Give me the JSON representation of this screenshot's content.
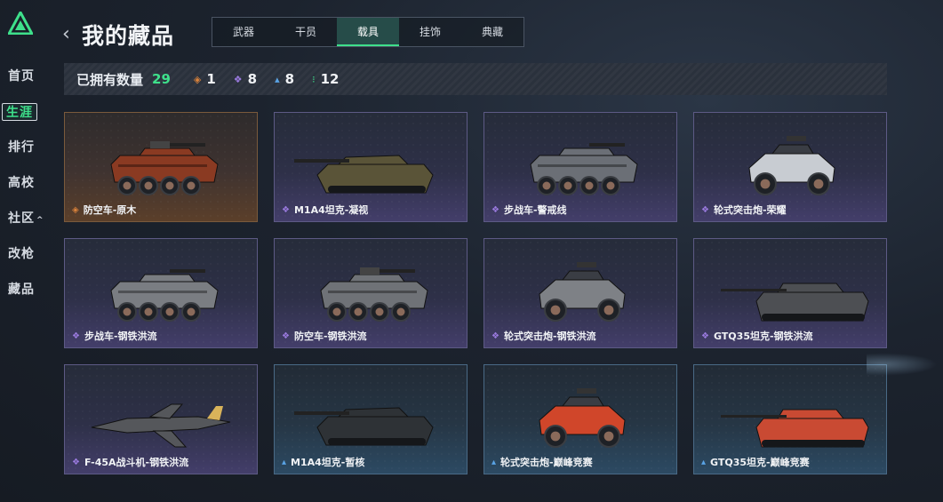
{
  "sidebar": {
    "items": [
      {
        "label": "首页"
      },
      {
        "label": "生涯",
        "active": true
      },
      {
        "label": "排行"
      },
      {
        "label": "高校"
      },
      {
        "label": "社区",
        "caret": "^"
      },
      {
        "label": "改枪"
      },
      {
        "label": "藏品"
      }
    ]
  },
  "header": {
    "back_icon": "‹",
    "title": "我的藏品",
    "tabs": [
      {
        "label": "武器"
      },
      {
        "label": "干员"
      },
      {
        "label": "载具",
        "active": true
      },
      {
        "label": "挂饰"
      },
      {
        "label": "典藏"
      }
    ]
  },
  "stats": {
    "owned_label": "已拥有数量",
    "owned_total": "29",
    "rarities": [
      {
        "icon": "orange-gem-icon",
        "color": "#d9823b",
        "count": "1"
      },
      {
        "icon": "purple-gem-icon",
        "color": "#9b7be0",
        "count": "8"
      },
      {
        "icon": "blue-gem-icon",
        "color": "#5aa4e6",
        "count": "8"
      },
      {
        "icon": "green-gem-icon",
        "color": "#3ee08b",
        "count": "12"
      }
    ]
  },
  "colors": {
    "accent": "#3ee08b",
    "orange": "#d9823b",
    "purple": "#9b7be0",
    "blue": "#5aa4e6"
  },
  "vehicles": [
    {
      "name": "防空车-原木",
      "rarity": "orange",
      "type": "wheeled-aa",
      "tint": "#8a3a22"
    },
    {
      "name": "M1A4坦克-凝视",
      "rarity": "purple",
      "type": "tank",
      "tint": "#5a5438"
    },
    {
      "name": "步战车-警戒线",
      "rarity": "purple",
      "type": "wheeled-ifv",
      "tint": "#6b6f76"
    },
    {
      "name": "轮式突击炮-荣耀",
      "rarity": "purple",
      "type": "buggy",
      "tint": "#c8ccd2"
    },
    {
      "name": "步战车-钢铁洪流",
      "rarity": "purple",
      "type": "wheeled-ifv",
      "tint": "#7a7d82"
    },
    {
      "name": "防空车-钢铁洪流",
      "rarity": "purple",
      "type": "wheeled-aa",
      "tint": "#6f7277"
    },
    {
      "name": "轮式突击炮-钢铁洪流",
      "rarity": "purple",
      "type": "buggy",
      "tint": "#7e8186"
    },
    {
      "name": "GTQ35坦克-钢铁洪流",
      "rarity": "purple",
      "type": "light-tank",
      "tint": "#4d4f53"
    },
    {
      "name": "F-45A战斗机-钢铁洪流",
      "rarity": "purple",
      "type": "jet",
      "tint": "#55575b"
    },
    {
      "name": "M1A4坦克-暂核",
      "rarity": "blue",
      "type": "tank",
      "tint": "#2e3236"
    },
    {
      "name": "轮式突击炮-巅峰竞赛",
      "rarity": "blue",
      "type": "buggy",
      "tint": "#d0462a"
    },
    {
      "name": "GTQ35坦克-巅峰竞赛",
      "rarity": "blue",
      "type": "light-tank",
      "tint": "#c94a33"
    }
  ]
}
